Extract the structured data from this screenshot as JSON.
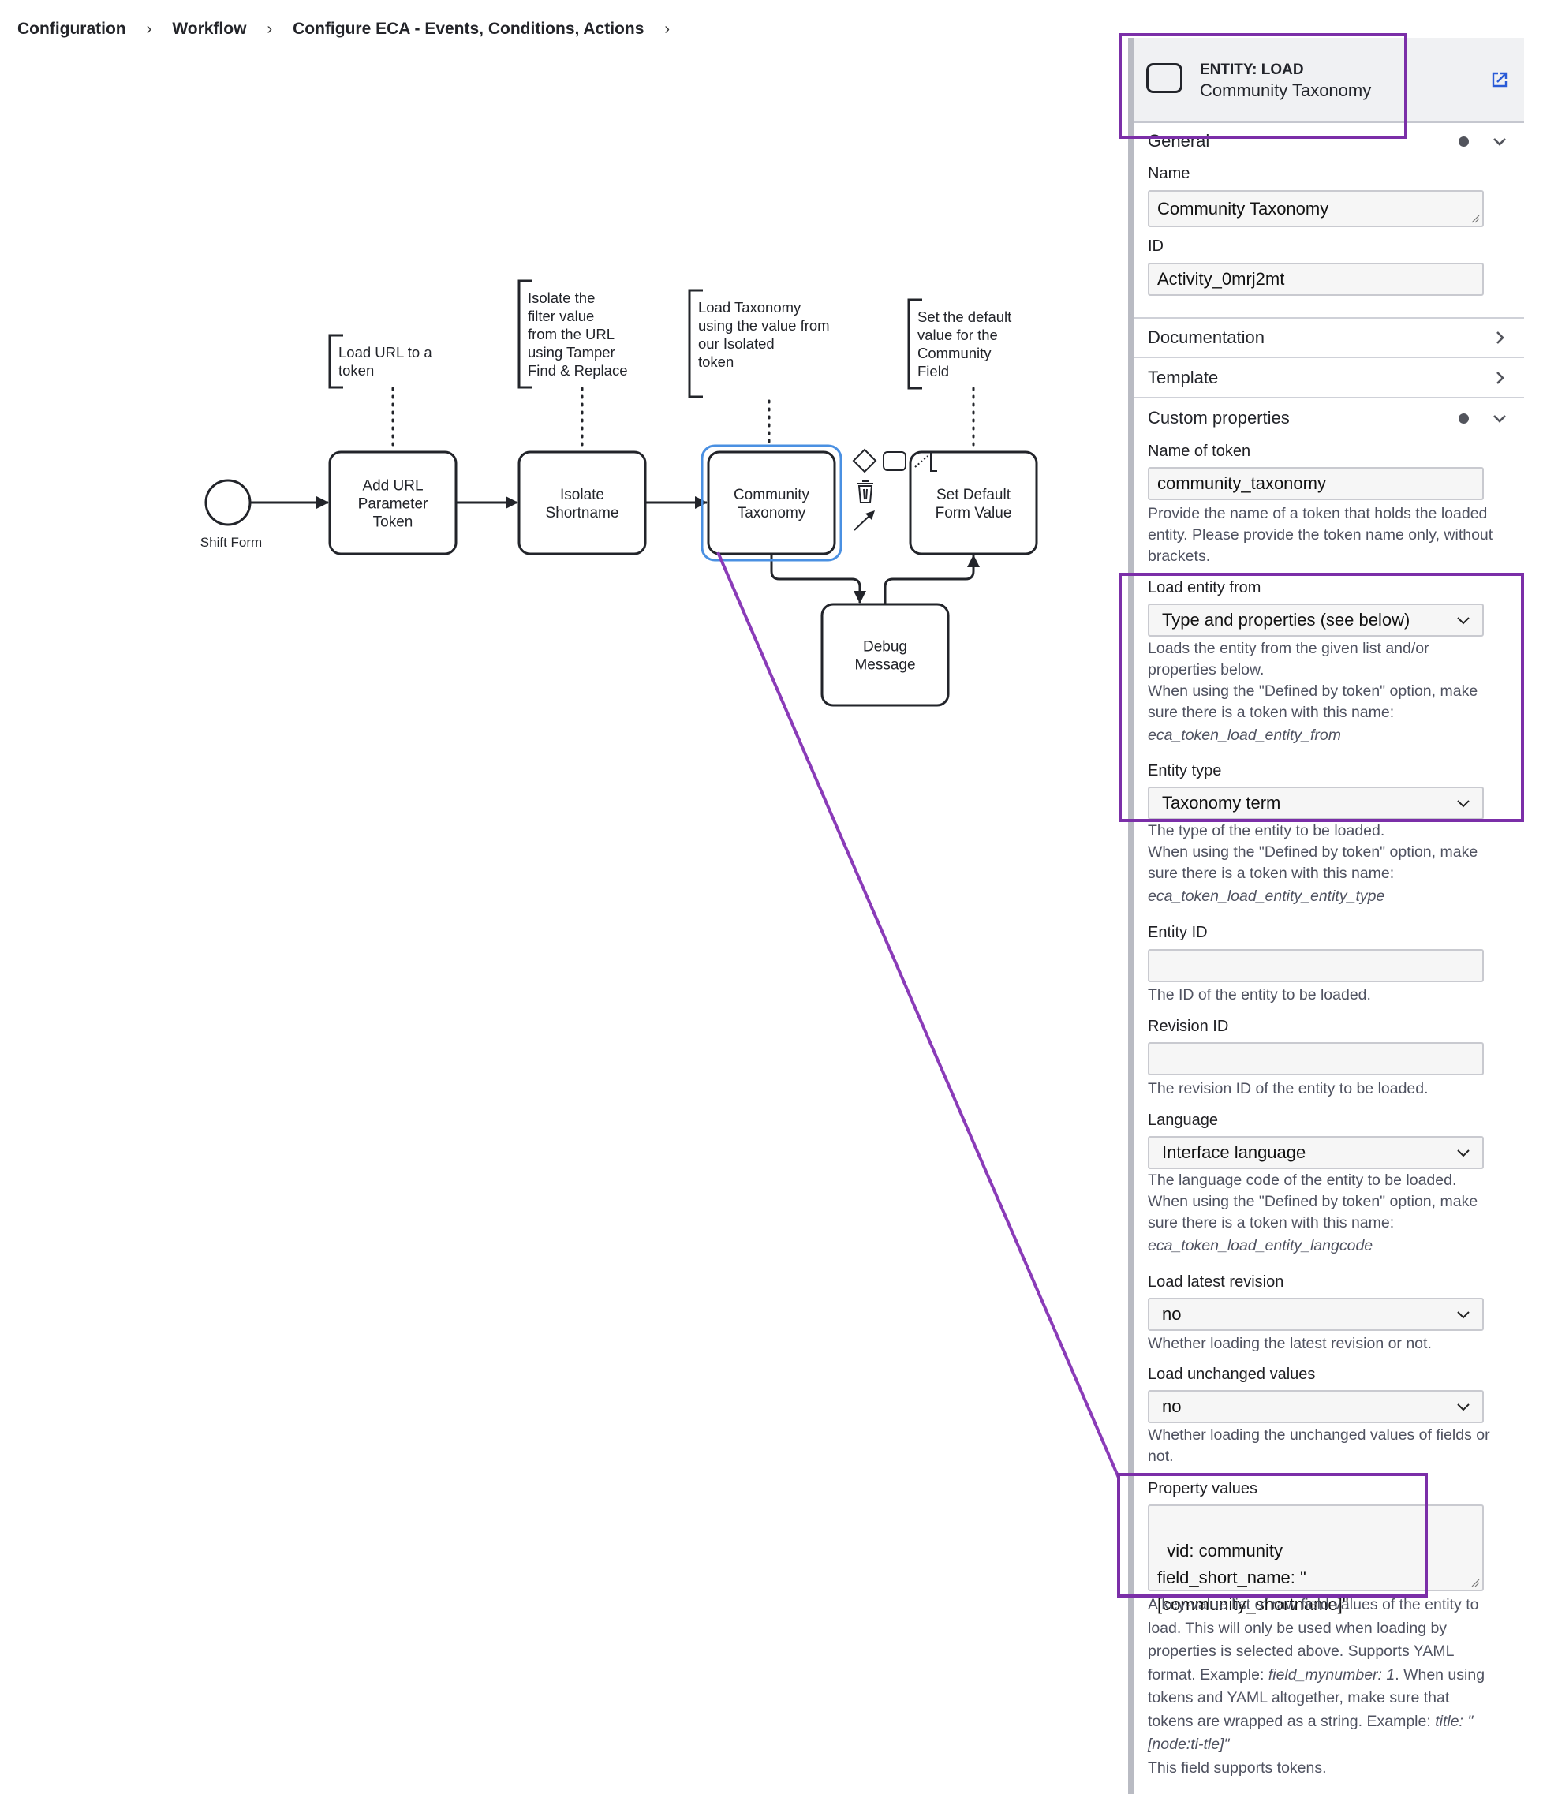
{
  "breadcrumb": {
    "items": [
      "Configuration",
      "Workflow",
      "Configure ECA - Events, Conditions, Actions"
    ],
    "separator": "›"
  },
  "diagram": {
    "start_event": {
      "label": "Shift Form"
    },
    "tasks": [
      {
        "id": "add-url",
        "lines": [
          "Add URL",
          "Parameter",
          "Token"
        ]
      },
      {
        "id": "isolate",
        "lines": [
          "Isolate",
          "Shortname"
        ]
      },
      {
        "id": "community",
        "lines": [
          "Community",
          "Taxonomy"
        ],
        "selected": true
      },
      {
        "id": "set-default",
        "lines": [
          "Set Default",
          "Form Value"
        ]
      },
      {
        "id": "debug",
        "lines": [
          "Debug",
          "Message"
        ]
      }
    ],
    "annotations": [
      {
        "for": "add-url",
        "lines": [
          "Load URL to a",
          "token"
        ]
      },
      {
        "for": "isolate",
        "lines": [
          "Isolate the",
          "filter value",
          "from the URL",
          "using Tamper",
          "Find & Replace"
        ]
      },
      {
        "for": "community",
        "lines": [
          "Load Taxonomy",
          "using the value from",
          "our Isolated",
          "token"
        ]
      },
      {
        "for": "set-default",
        "lines": [
          "Set the default",
          "value for the",
          "Community",
          "Field"
        ]
      }
    ],
    "context_pad": [
      "gateway-icon",
      "task-icon",
      "annotation-icon",
      "delete-icon",
      "connect-arrow-icon"
    ],
    "colors": {
      "selection": "#4a90e2",
      "stroke": "#22242a",
      "highlight": "#7b2fa8"
    }
  },
  "panel": {
    "header": {
      "type": "ENTITY: LOAD",
      "name": "Community Taxonomy"
    },
    "sections": {
      "general": "General",
      "documentation": "Documentation",
      "template": "Template",
      "custom_properties": "Custom properties"
    },
    "general": {
      "name_label": "Name",
      "name_value": "Community Taxonomy",
      "id_label": "ID",
      "id_value": "Activity_0mrj2mt"
    },
    "custom": {
      "token_label": "Name of token",
      "token_value": "community_taxonomy",
      "token_help": "Provide the name of a token that holds the loaded entity. Please provide the token name only, without brackets.",
      "from_label": "Load entity from",
      "from_value": "Type and properties (see below)",
      "from_help1": "Loads the entity from the given list and/or properties below.",
      "from_help2": "When using the \"Defined by token\" option, make sure there is a token with this name:",
      "from_token": "eca_token_load_entity_from",
      "type_label": "Entity type",
      "type_value": "Taxonomy term",
      "type_help1": "The type of the entity to be loaded.",
      "type_help2": "When using the \"Defined by token\" option, make sure there is a token with this name:",
      "type_token": "eca_token_load_entity_entity_type",
      "entity_id_label": "Entity ID",
      "entity_id_value": "",
      "entity_id_help": "The ID of the entity to be loaded.",
      "revision_label": "Revision ID",
      "revision_value": "",
      "revision_help": "The revision ID of the entity to be loaded.",
      "lang_label": "Language",
      "lang_value": "Interface language",
      "lang_help1": "The language code of the entity to be loaded.",
      "lang_help2": "When using the \"Defined by token\" option, make sure there is a token with this name:",
      "lang_token": "eca_token_load_entity_langcode",
      "latest_label": "Load latest revision",
      "latest_value": "no",
      "latest_help": "Whether loading the latest revision or not.",
      "unchanged_label": "Load unchanged values",
      "unchanged_value": "no",
      "unchanged_help": "Whether loading the unchanged values of fields or not.",
      "props_label": "Property values",
      "props_value": "vid: community\nfield_short_name: \"\n[community_shortname]\"",
      "props_help_a": "A key-value list of raw field values of the entity to load. This will only be used when loading by properties is selected above. Supports YAML format. Example: ",
      "props_help_ex1": "field_mynumber: 1",
      "props_help_b": ". When using tokens and YAML altogether, make sure that tokens are wrapped as a string. Example: ",
      "props_help_ex2": "title: \"[node:ti-tle]\"",
      "props_help_c": "This field supports tokens."
    }
  }
}
